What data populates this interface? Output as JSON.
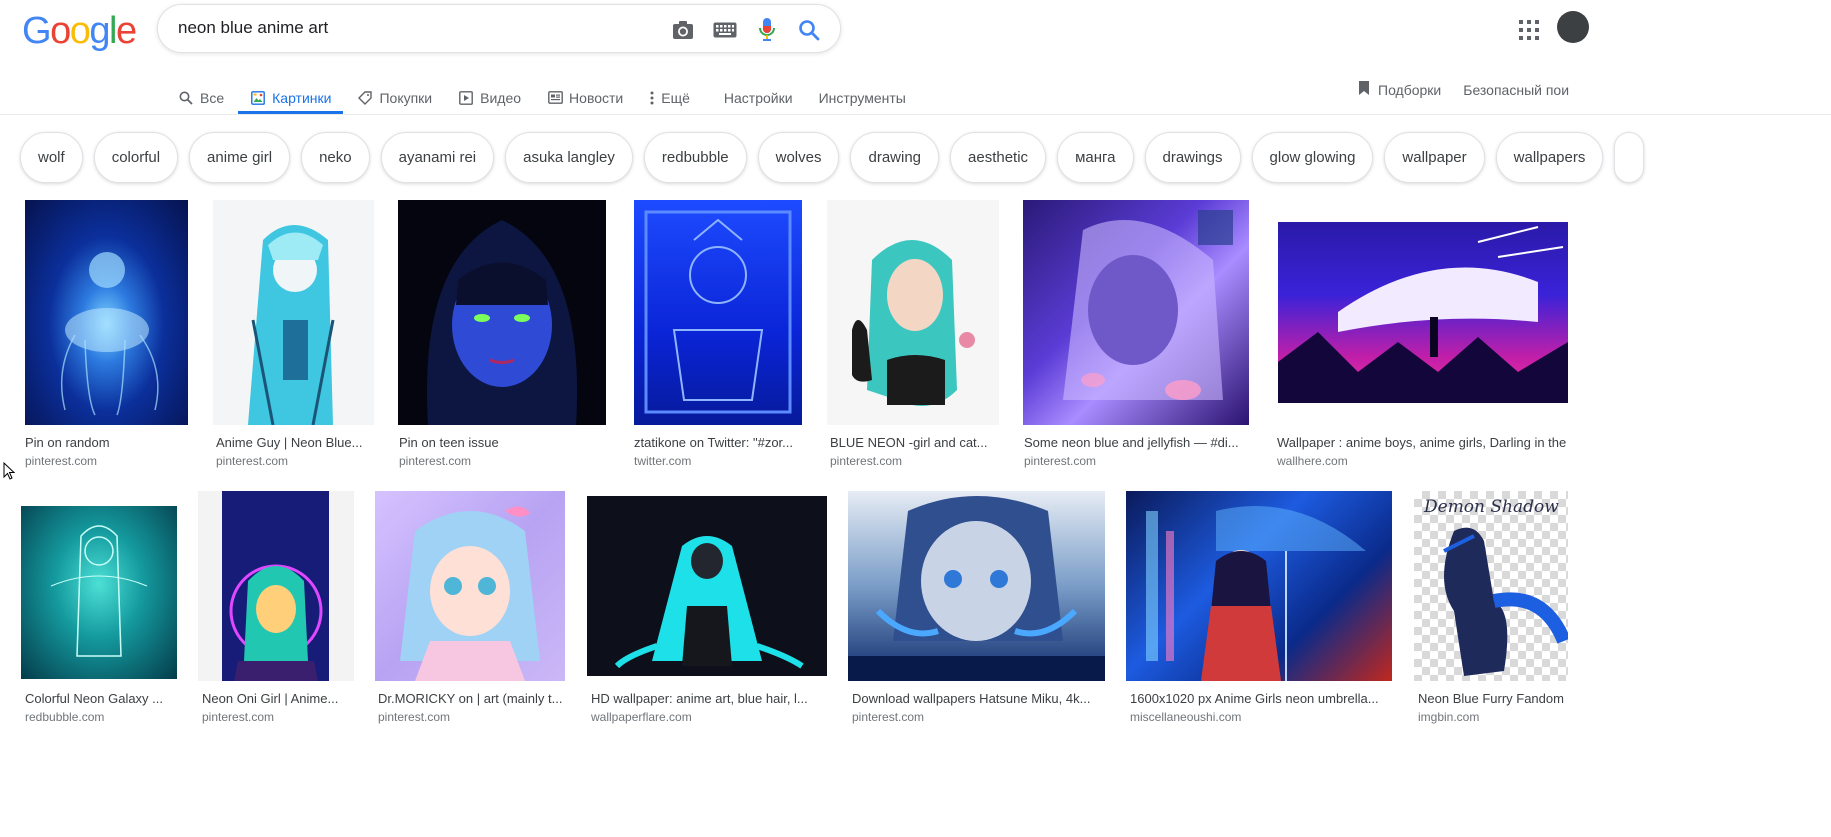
{
  "logo": {
    "letters": [
      "G",
      "o",
      "o",
      "g",
      "l",
      "e"
    ],
    "colors": [
      "#4285F4",
      "#EA4335",
      "#FBBC05",
      "#4285F4",
      "#34A853",
      "#EA4335"
    ]
  },
  "search": {
    "query": "neon blue anime art",
    "icons": [
      "camera-icon",
      "keyboard-icon",
      "mic-icon",
      "search-icon"
    ]
  },
  "tabs": [
    {
      "label": "Все",
      "icon": "search-icon",
      "active": false
    },
    {
      "label": "Картинки",
      "icon": "image-icon",
      "active": true
    },
    {
      "label": "Покупки",
      "icon": "tag-icon",
      "active": false
    },
    {
      "label": "Видео",
      "icon": "play-icon",
      "active": false
    },
    {
      "label": "Новости",
      "icon": "news-icon",
      "active": false
    },
    {
      "label": "Ещё",
      "icon": "more-icon",
      "active": false
    },
    {
      "label": "Настройки",
      "icon": "",
      "active": false
    },
    {
      "label": "Инструменты",
      "icon": "",
      "active": false
    }
  ],
  "right_links": {
    "collections": "Подборки",
    "safe_search": "Безопасный пои"
  },
  "chips": [
    "wolf",
    "colorful",
    "anime girl",
    "neko",
    "ayanami rei",
    "asuka langley",
    "redbubble",
    "wolves",
    "drawing",
    "aesthetic",
    "манга",
    "drawings",
    "glow glowing",
    "wallpaper",
    "wallpapers"
  ],
  "row1": [
    {
      "title": "Pin on random",
      "source": "pinterest.com"
    },
    {
      "title": "Anime Guy | Neon Blue...",
      "source": "pinterest.com"
    },
    {
      "title": "Pin on teen issue",
      "source": "pinterest.com"
    },
    {
      "title": "ztatikone on Twitter: \"#zor...",
      "source": "twitter.com"
    },
    {
      "title": "BLUE NEON -girl and cat...",
      "source": "pinterest.com"
    },
    {
      "title": "Some neon blue and jellyfish — #di...",
      "source": "pinterest.com"
    },
    {
      "title": "Wallpaper : anime boys, anime girls, Darling in the",
      "source": "wallhere.com"
    }
  ],
  "row2": [
    {
      "title": "Colorful Neon Galaxy ...",
      "source": "redbubble.com"
    },
    {
      "title": "Neon Oni Girl | Anime...",
      "source": "pinterest.com"
    },
    {
      "title": "Dr.MORICKY on | art (mainly t...",
      "source": "pinterest.com"
    },
    {
      "title": "HD wallpaper: anime art, blue hair, l...",
      "source": "wallpaperflare.com"
    },
    {
      "title": "Download wallpapers Hatsune Miku, 4k...",
      "source": "pinterest.com"
    },
    {
      "title": "1600x1020 px Anime Girls neon umbrella...",
      "source": "miscellaneoushi.com"
    },
    {
      "title": "Neon Blue Furry Fandom",
      "source": "imgbin.com"
    }
  ],
  "row2_watermark": "Demon Shadow"
}
